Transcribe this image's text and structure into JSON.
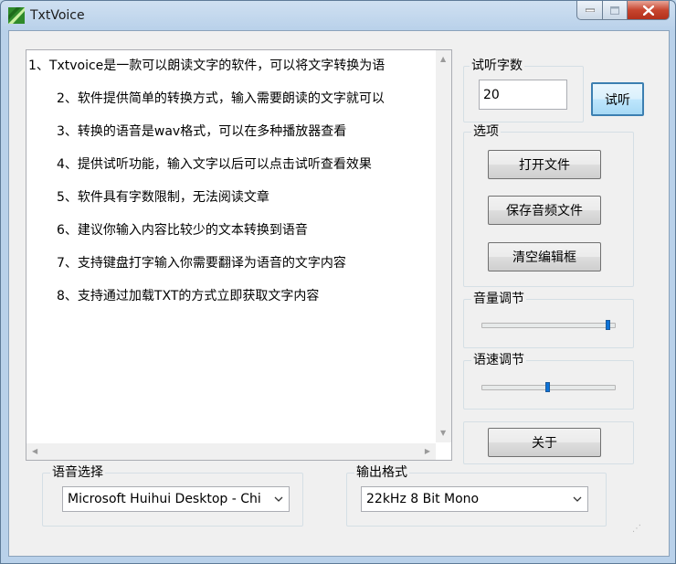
{
  "window": {
    "title": "TxtVoice"
  },
  "text_content": [
    "1、Txtvoice是一款可以朗读文字的软件，可以将文字转换为语",
    "2、软件提供简单的转换方式，输入需要朗读的文字就可以",
    "3、转换的语音是wav格式，可以在多种播放器查看",
    "4、提供试听功能，输入文字以后可以点击试听查看效果",
    "5、软件具有字数限制，无法阅读文章",
    "6、建议你输入内容比较少的文本转换到语音",
    "7、支持键盘打字输入你需要翻译为语音的文字内容",
    "8、支持通过加载TXT的方式立即获取文字内容"
  ],
  "preview": {
    "label": "试听字数",
    "value": "20",
    "button": "试听"
  },
  "options": {
    "label": "选项",
    "open_file": "打开文件",
    "save_audio": "保存音频文件",
    "clear_editor": "清空编辑框"
  },
  "volume": {
    "label": "音量调节",
    "level": 0.97
  },
  "speed": {
    "label": "语速调节",
    "level": 0.5
  },
  "about": {
    "button": "关于"
  },
  "voice_select": {
    "label": "语音选择",
    "selected": "Microsoft Huihui Desktop - Chi"
  },
  "output_format": {
    "label": "输出格式",
    "selected": "22kHz 8 Bit Mono"
  },
  "colors": {
    "title_bar": "#b9d1ea",
    "close_button": "#c7452f",
    "slider_thumb": "#0e73d8"
  }
}
